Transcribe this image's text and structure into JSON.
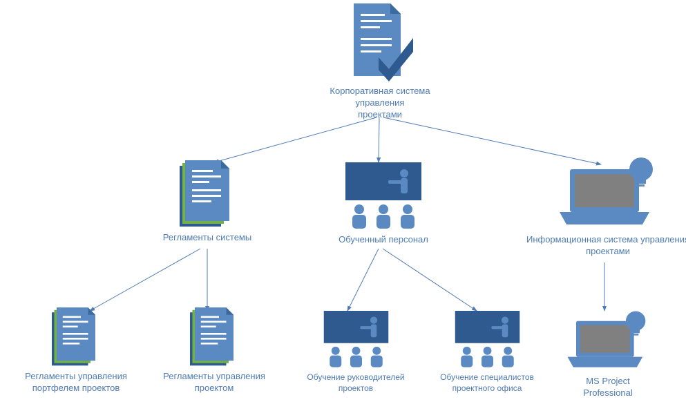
{
  "nodes": {
    "root": {
      "label": "Корпоративная система управления\nпроектами"
    },
    "reglamenty": {
      "label": "Регламенты системы"
    },
    "personal": {
      "label": "Обученный персонал"
    },
    "infosys": {
      "label": "Информационная система управления\nпроектами"
    },
    "regl_portfolio": {
      "label": "Регламенты управления\nпортфелем проектов"
    },
    "regl_project": {
      "label": "Регламенты управления\nпроектом"
    },
    "training_leaders": {
      "label": "Обучение руководителей\nпроектов"
    },
    "training_spec": {
      "label": "Обучение специалистов\nпроектного офиса"
    },
    "msproject": {
      "label": "MS Project\nProfessional"
    }
  },
  "colors": {
    "primary": "#4e7bb4",
    "dark": "#2e5a8f",
    "accent_green": "#71b145",
    "screen_gray": "#808080"
  }
}
